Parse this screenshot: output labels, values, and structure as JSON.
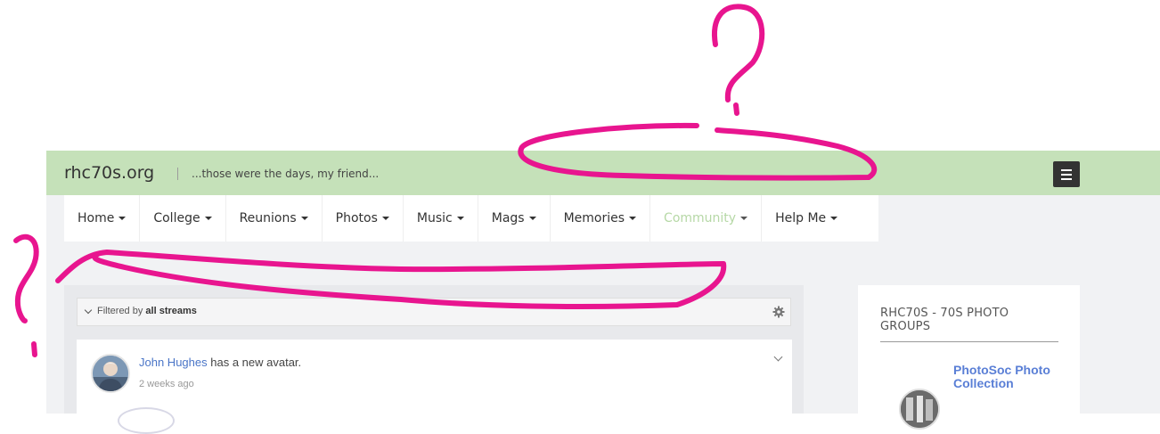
{
  "header": {
    "site_title": "rhc70s.org",
    "tagline": "...those were the days, my friend...",
    "menu_icon": "hamburger-icon",
    "bg_color": "#c5e1b9"
  },
  "nav": {
    "items": [
      {
        "label": "Home"
      },
      {
        "label": "College"
      },
      {
        "label": "Reunions"
      },
      {
        "label": "Photos"
      },
      {
        "label": "Music"
      },
      {
        "label": "Mags"
      },
      {
        "label": "Memories"
      },
      {
        "label": "Community",
        "active": true
      },
      {
        "label": "Help Me"
      }
    ],
    "active_color": "#b6d8a6"
  },
  "stream": {
    "filter_prefix": "Filtered by",
    "filter_value": "all streams",
    "activity": {
      "user": "John Hughes",
      "action": "has a new avatar.",
      "time": "2 weeks ago"
    }
  },
  "sidebar": {
    "title": "RHC70S - 70S PHOTO GROUPS",
    "group": {
      "name": "PhotoSoc Photo Collection"
    }
  },
  "annotation": {
    "color": "#e8158f",
    "marks": [
      "?",
      "?"
    ]
  }
}
